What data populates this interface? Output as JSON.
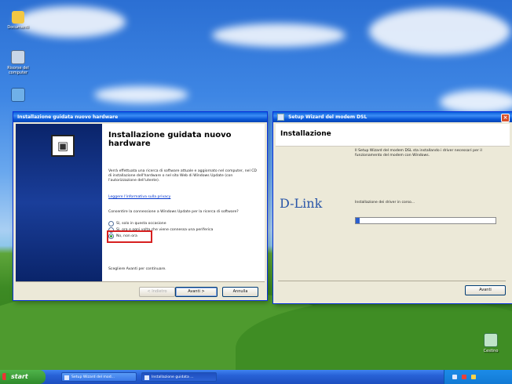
{
  "colors": {
    "titlebar": "#0a5fdc",
    "wizard_side_panel": "#0a246a",
    "highlight_border": "#d72020",
    "dlink_logo": "#2a56a8",
    "progress_fill": "#2b5fcf",
    "start_button": "#3a9a35"
  },
  "desktop": {
    "icons": [
      {
        "label": "Documenti",
        "icon": "folder-icon"
      },
      {
        "label": "Risorse del computer",
        "icon": "computer-icon"
      },
      {
        "label": "",
        "icon": "network-icon"
      },
      {
        "label": "Cestino",
        "icon": "recycle-bin-icon"
      }
    ]
  },
  "wizard": {
    "title": "Installazione guidata nuovo hardware",
    "heading": "Installazione guidata nuovo hardware",
    "intro": "Verrà effettuata una ricerca di software attuale e aggiornato nel computer, nel CD di installazione dell'hardware o nel sito Web di Windows Update (con l'autorizzazione dell'utente).",
    "privacy_link": "Leggere l'informativa sulla privacy",
    "question": "Consentire la connessione a Windows Update per la ricerca di software?",
    "options": [
      {
        "label": "Sì, solo in questa occasione",
        "selected": false
      },
      {
        "label": "Sì, ora e ogni volta che viene connessa una periferica",
        "selected": false
      },
      {
        "label": "No, non ora",
        "selected": true
      }
    ],
    "footer_text": "Scegliere Avanti per continuare.",
    "buttons": {
      "back": "< Indietro",
      "next": "Avanti >",
      "cancel": "Annulla"
    }
  },
  "setup": {
    "title": "Setup Wizard del modem DSL",
    "heading": "Installazione",
    "logo": "D-Link",
    "description": "Il Setup Wizard del modem DSL sta installando i driver necessari per il funzionamento del modem con Windows.",
    "status": "Installazione dei driver in corso...",
    "progress": 0.03,
    "buttons": {
      "next": "Avanti"
    }
  },
  "taskbar": {
    "start_label": "start",
    "tasks": [
      {
        "label": "Setup Wizard del mod...",
        "active": false
      },
      {
        "label": "Installazione guidata ...",
        "active": true
      }
    ],
    "tray_icons": [
      "network-tray-icon",
      "security-tray-icon",
      "volume-tray-icon"
    ],
    "clock": ""
  }
}
